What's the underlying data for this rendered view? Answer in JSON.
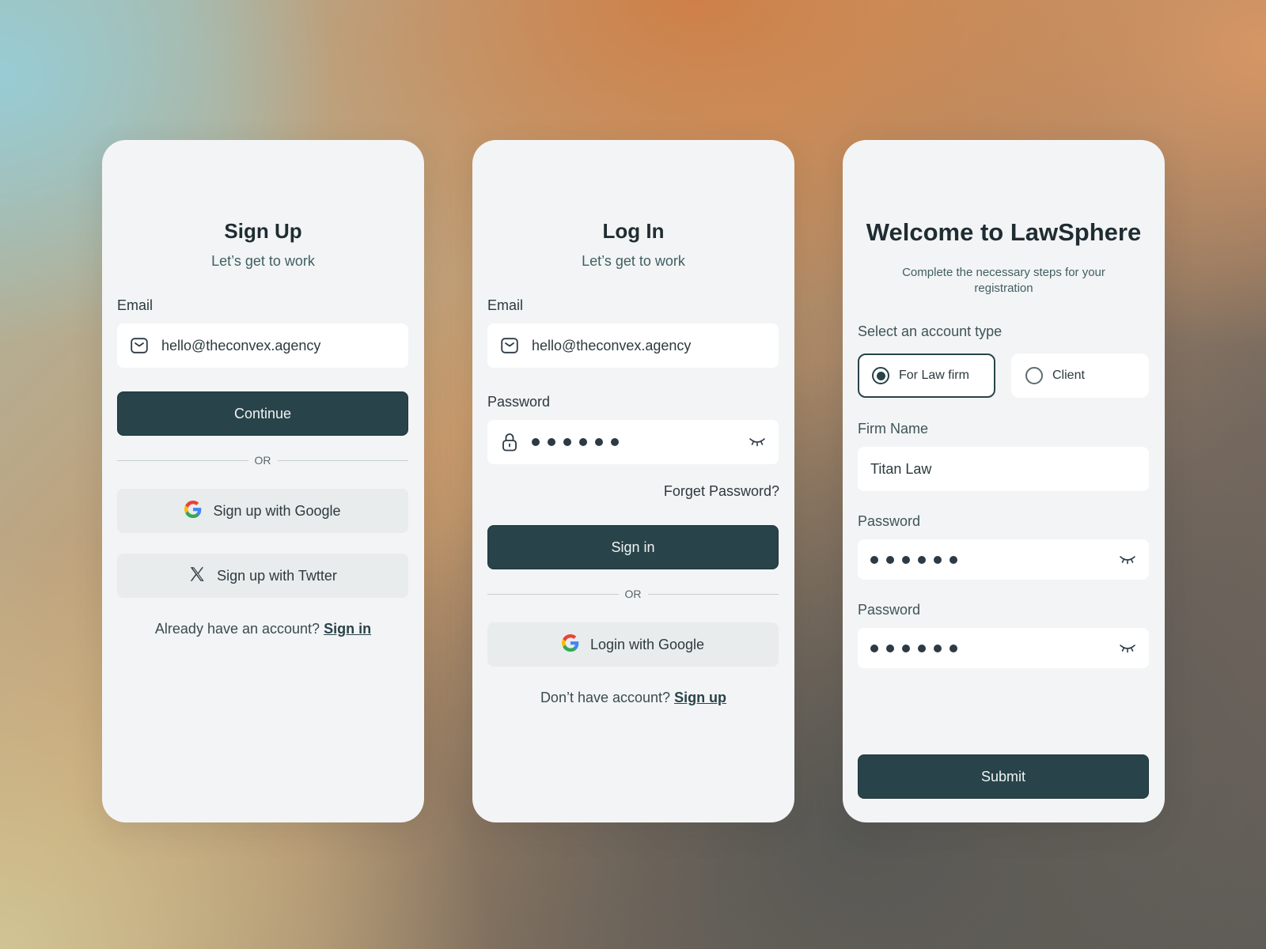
{
  "signup": {
    "title": "Sign Up",
    "subtitle": "Let’s get to work",
    "email_label": "Email",
    "email_value": "hello@theconvex.agency",
    "continue_label": "Continue",
    "or_label": "OR",
    "google_label": "Sign up with Google",
    "twitter_label": "Sign up with Twtter",
    "footer_text": "Already have an account?",
    "footer_link": "Sign in"
  },
  "login": {
    "title": "Log In",
    "subtitle": "Let’s get to work",
    "email_label": "Email",
    "email_value": "hello@theconvex.agency",
    "password_label": "Password",
    "forget_password": "Forget Password?",
    "signin_label": "Sign in",
    "or_label": "OR",
    "google_label": "Login with Google",
    "footer_text": "Don’t have account?",
    "footer_link": "Sign up"
  },
  "welcome": {
    "title": "Welcome to LawSphere",
    "subtitle": "Complete the necessary steps for your registration",
    "account_type_label": "Select an account type",
    "account_types": [
      {
        "label": "For Law firm",
        "selected": true
      },
      {
        "label": "Client",
        "selected": false
      }
    ],
    "firm_name_label": "Firm Name",
    "firm_name_value": "Titan Law",
    "password_label": "Password",
    "password2_label": "Password",
    "submit_label": "Submit"
  },
  "colors": {
    "primary": "#28434a",
    "card_bg": "#f3f4f5"
  }
}
